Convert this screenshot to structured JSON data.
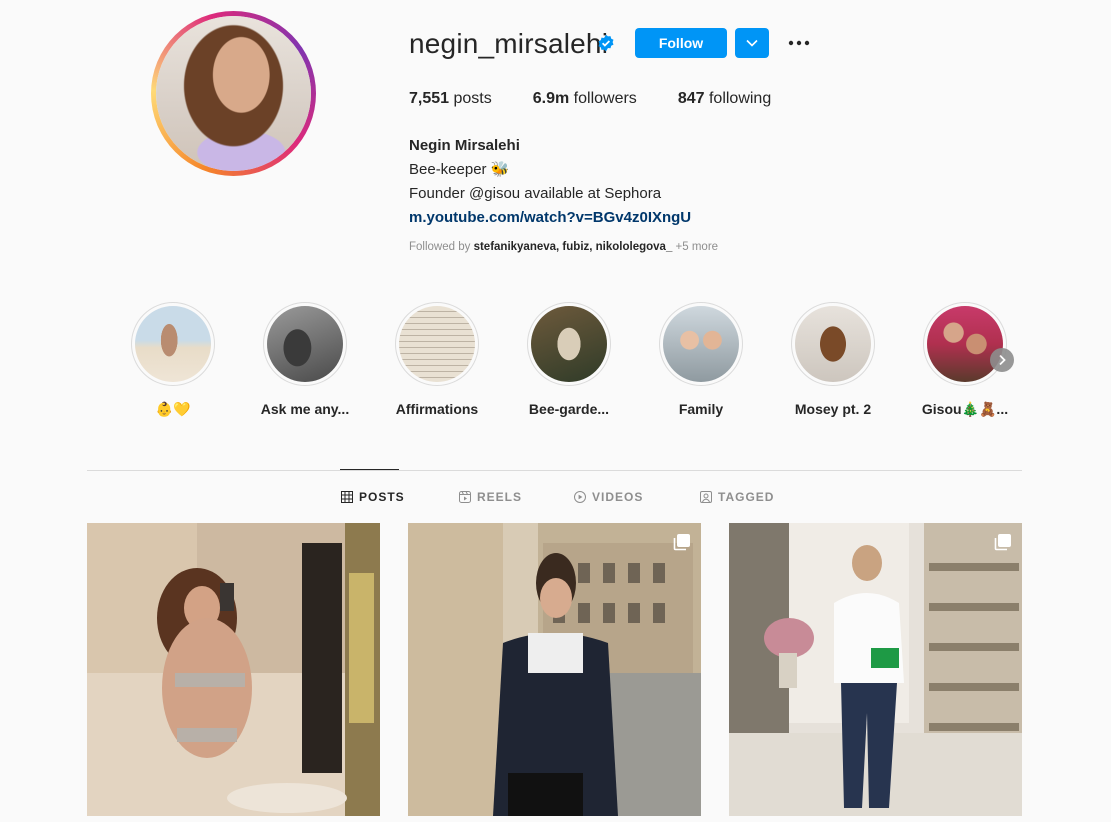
{
  "profile": {
    "username": "negin_mirsalehi",
    "follow_label": "Follow",
    "stats": {
      "posts_count": "7,551",
      "posts_label": "posts",
      "followers_count": "6.9m",
      "followers_label": "followers",
      "following_count": "847",
      "following_label": "following"
    },
    "bio": {
      "name": "Negin Mirsalehi",
      "line1": "Bee-keeper 🐝",
      "line2": "Founder @gisou available at Sephora",
      "link": "m.youtube.com/watch?v=BGv4z0IXngU"
    },
    "followed_by": {
      "prefix": "Followed by",
      "names": "stefanikyaneva, fubiz, nikololegova_",
      "more": "+5 more"
    }
  },
  "highlights": [
    {
      "label": "👶💛"
    },
    {
      "label": "Ask me any..."
    },
    {
      "label": "Affirmations"
    },
    {
      "label": "Bee-garde..."
    },
    {
      "label": "Family"
    },
    {
      "label": "Mosey pt. 2"
    },
    {
      "label": "Gisou🎄🧸..."
    }
  ],
  "tabs": [
    {
      "label": "POSTS",
      "icon": "grid-icon"
    },
    {
      "label": "REELS",
      "icon": "reels-icon"
    },
    {
      "label": "VIDEOS",
      "icon": "play-icon"
    },
    {
      "label": "TAGGED",
      "icon": "tagged-icon"
    }
  ],
  "colors": {
    "accent": "#0095f6",
    "link": "#00376b",
    "muted": "#8e8e8e"
  }
}
